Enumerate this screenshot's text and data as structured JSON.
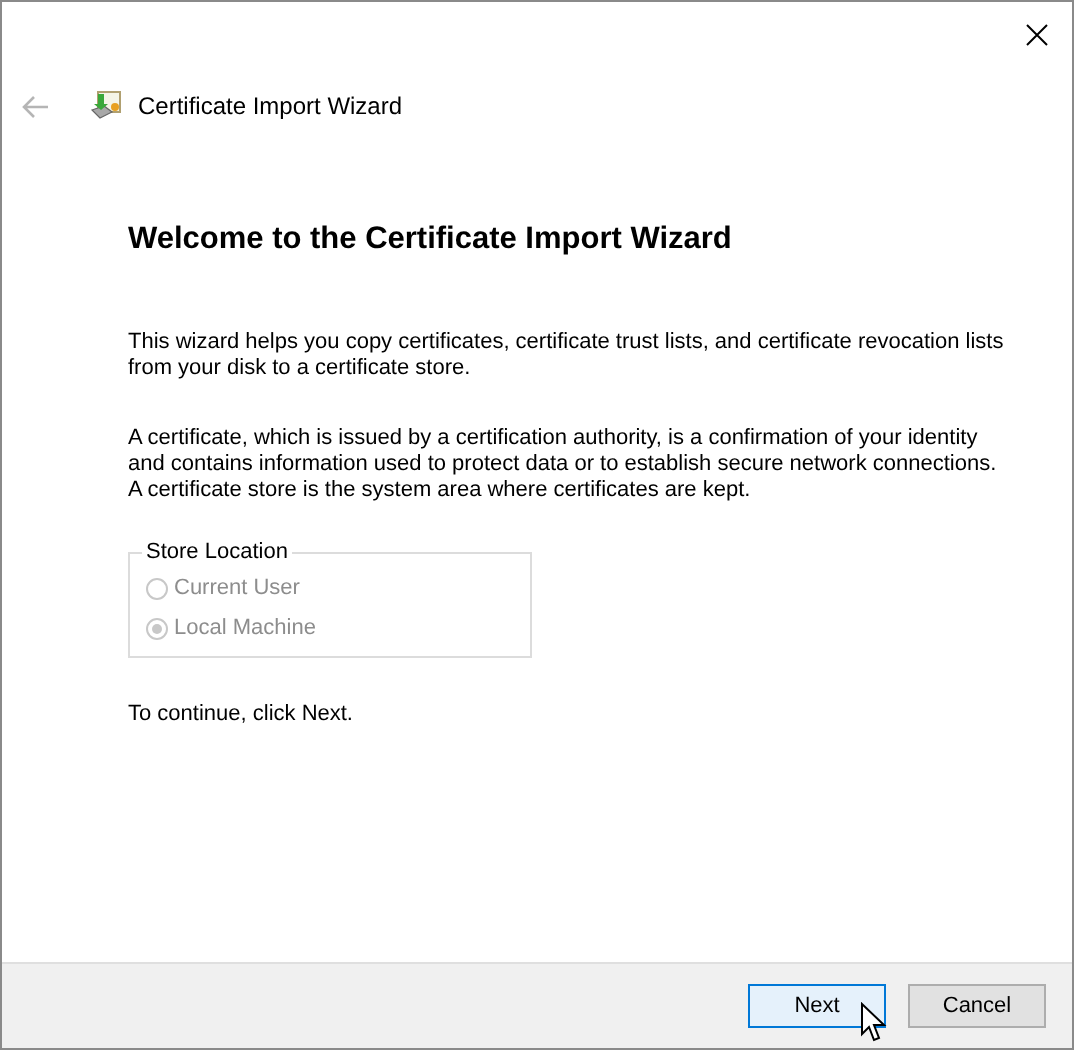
{
  "window": {
    "title": "Certificate Import Wizard"
  },
  "heading": "Welcome to the Certificate Import Wizard",
  "paragraphs": [
    "This wizard helps you copy certificates, certificate trust lists, and certificate revocation lists from your disk to a certificate store.",
    "A certificate, which is issued by a certification authority, is a confirmation of your identity and contains information used to protect data or to establish secure network connections. A certificate store is the system area where certificates are kept."
  ],
  "store_location": {
    "title": "Store Location",
    "options": [
      {
        "label": "Current User",
        "selected": false,
        "disabled": true
      },
      {
        "label": "Local Machine",
        "selected": true,
        "disabled": true
      }
    ]
  },
  "instruction": "To continue, click Next.",
  "buttons": [
    {
      "label": "Next",
      "kind": "default"
    },
    {
      "label": "Cancel",
      "kind": "normal"
    }
  ]
}
